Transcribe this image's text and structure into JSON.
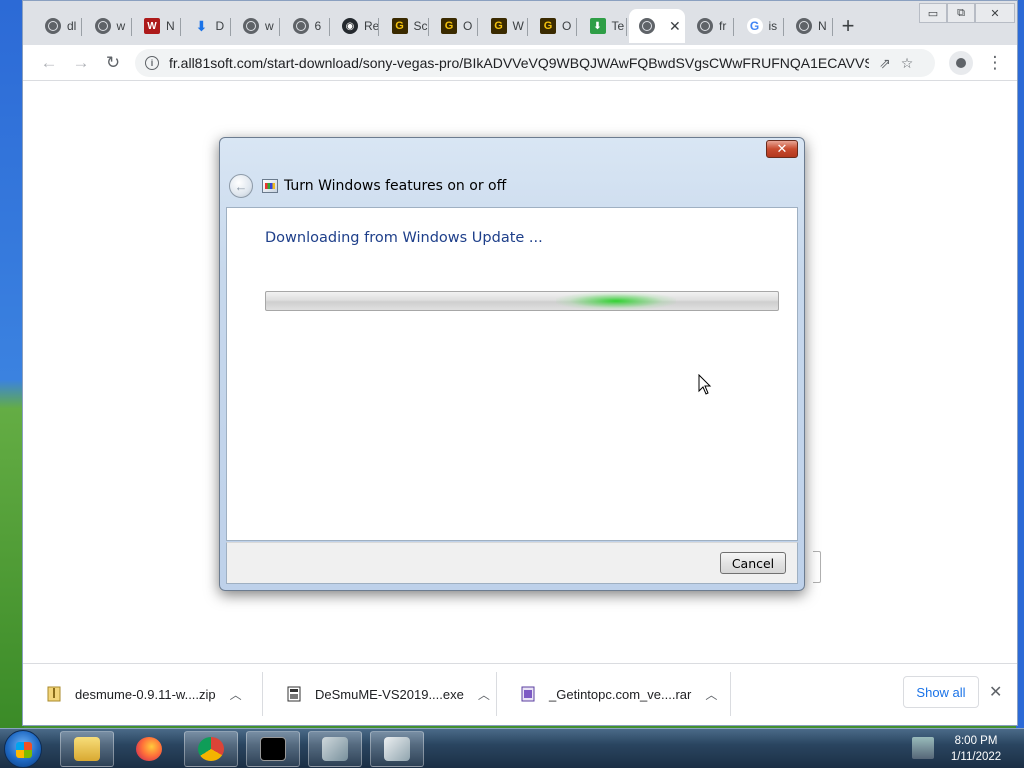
{
  "browser": {
    "tabs": [
      {
        "label": "dl",
        "favicon": "globe-icon"
      },
      {
        "label": "w",
        "favicon": "globe-icon"
      },
      {
        "label": "N",
        "favicon": "wd-icon"
      },
      {
        "label": "D",
        "favicon": "download-icon"
      },
      {
        "label": "w",
        "favicon": "globe-icon"
      },
      {
        "label": "6",
        "favicon": "globe-icon"
      },
      {
        "label": "Re",
        "favicon": "github-icon"
      },
      {
        "label": "Sc",
        "favicon": "g-icon"
      },
      {
        "label": "O",
        "favicon": "g-icon"
      },
      {
        "label": "W",
        "favicon": "g-icon"
      },
      {
        "label": "O",
        "favicon": "g-icon"
      },
      {
        "label": "Te",
        "favicon": "te-icon"
      },
      {
        "label": "",
        "favicon": "globe-icon",
        "active": true
      },
      {
        "label": "fr",
        "favicon": "globe-icon"
      },
      {
        "label": "is",
        "favicon": "google-icon"
      },
      {
        "label": "N",
        "favicon": "chrome-icon"
      }
    ],
    "new_tab": "+",
    "window_controls": {
      "minimize": "▭",
      "restore": "⧉",
      "close": "✕"
    },
    "address": "fr.all81soft.com/start-download/sony-vegas-pro/BIkADVVeVQ9WBQJWAwFQBwdSVgsCWwFRUFNQA1ECAVVSV..."
  },
  "dialog": {
    "title": "Turn Windows features on or off",
    "heading": "Downloading from Windows Update ...",
    "progress_state": "indeterminate",
    "cancel_label": "Cancel",
    "close_glyph": "✕"
  },
  "downloads": {
    "items": [
      {
        "name": "desmume-0.9.11-w....zip",
        "icon": "zip-file-icon"
      },
      {
        "name": "DeSmuME-VS2019....exe",
        "icon": "exe-file-icon"
      },
      {
        "name": "_Getintopc.com_ve....rar",
        "icon": "rar-file-icon"
      }
    ],
    "show_all_label": "Show all"
  },
  "taskbar": {
    "time": "8:00 PM",
    "date": "1/11/2022"
  },
  "colors": {
    "accent": "#1a73e8",
    "dialog_heading": "#1e3f8a",
    "progress_glow": "#2ed22e"
  }
}
